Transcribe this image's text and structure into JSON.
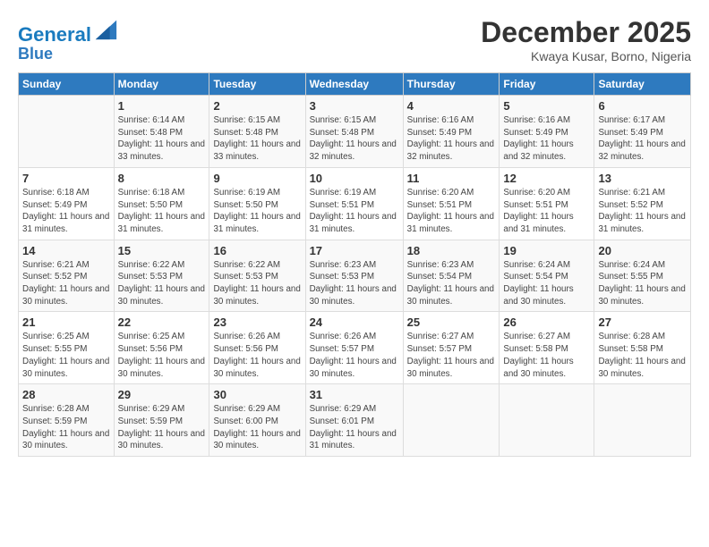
{
  "header": {
    "logo_line1": "General",
    "logo_line2": "Blue",
    "month": "December 2025",
    "location": "Kwaya Kusar, Borno, Nigeria"
  },
  "days_of_week": [
    "Sunday",
    "Monday",
    "Tuesday",
    "Wednesday",
    "Thursday",
    "Friday",
    "Saturday"
  ],
  "weeks": [
    [
      {
        "day": "",
        "info": ""
      },
      {
        "day": "1",
        "info": "Sunrise: 6:14 AM\nSunset: 5:48 PM\nDaylight: 11 hours and 33 minutes."
      },
      {
        "day": "2",
        "info": "Sunrise: 6:15 AM\nSunset: 5:48 PM\nDaylight: 11 hours and 33 minutes."
      },
      {
        "day": "3",
        "info": "Sunrise: 6:15 AM\nSunset: 5:48 PM\nDaylight: 11 hours and 32 minutes."
      },
      {
        "day": "4",
        "info": "Sunrise: 6:16 AM\nSunset: 5:49 PM\nDaylight: 11 hours and 32 minutes."
      },
      {
        "day": "5",
        "info": "Sunrise: 6:16 AM\nSunset: 5:49 PM\nDaylight: 11 hours and 32 minutes."
      },
      {
        "day": "6",
        "info": "Sunrise: 6:17 AM\nSunset: 5:49 PM\nDaylight: 11 hours and 32 minutes."
      }
    ],
    [
      {
        "day": "7",
        "info": "Sunrise: 6:18 AM\nSunset: 5:49 PM\nDaylight: 11 hours and 31 minutes."
      },
      {
        "day": "8",
        "info": "Sunrise: 6:18 AM\nSunset: 5:50 PM\nDaylight: 11 hours and 31 minutes."
      },
      {
        "day": "9",
        "info": "Sunrise: 6:19 AM\nSunset: 5:50 PM\nDaylight: 11 hours and 31 minutes."
      },
      {
        "day": "10",
        "info": "Sunrise: 6:19 AM\nSunset: 5:51 PM\nDaylight: 11 hours and 31 minutes."
      },
      {
        "day": "11",
        "info": "Sunrise: 6:20 AM\nSunset: 5:51 PM\nDaylight: 11 hours and 31 minutes."
      },
      {
        "day": "12",
        "info": "Sunrise: 6:20 AM\nSunset: 5:51 PM\nDaylight: 11 hours and 31 minutes."
      },
      {
        "day": "13",
        "info": "Sunrise: 6:21 AM\nSunset: 5:52 PM\nDaylight: 11 hours and 31 minutes."
      }
    ],
    [
      {
        "day": "14",
        "info": "Sunrise: 6:21 AM\nSunset: 5:52 PM\nDaylight: 11 hours and 30 minutes."
      },
      {
        "day": "15",
        "info": "Sunrise: 6:22 AM\nSunset: 5:53 PM\nDaylight: 11 hours and 30 minutes."
      },
      {
        "day": "16",
        "info": "Sunrise: 6:22 AM\nSunset: 5:53 PM\nDaylight: 11 hours and 30 minutes."
      },
      {
        "day": "17",
        "info": "Sunrise: 6:23 AM\nSunset: 5:53 PM\nDaylight: 11 hours and 30 minutes."
      },
      {
        "day": "18",
        "info": "Sunrise: 6:23 AM\nSunset: 5:54 PM\nDaylight: 11 hours and 30 minutes."
      },
      {
        "day": "19",
        "info": "Sunrise: 6:24 AM\nSunset: 5:54 PM\nDaylight: 11 hours and 30 minutes."
      },
      {
        "day": "20",
        "info": "Sunrise: 6:24 AM\nSunset: 5:55 PM\nDaylight: 11 hours and 30 minutes."
      }
    ],
    [
      {
        "day": "21",
        "info": "Sunrise: 6:25 AM\nSunset: 5:55 PM\nDaylight: 11 hours and 30 minutes."
      },
      {
        "day": "22",
        "info": "Sunrise: 6:25 AM\nSunset: 5:56 PM\nDaylight: 11 hours and 30 minutes."
      },
      {
        "day": "23",
        "info": "Sunrise: 6:26 AM\nSunset: 5:56 PM\nDaylight: 11 hours and 30 minutes."
      },
      {
        "day": "24",
        "info": "Sunrise: 6:26 AM\nSunset: 5:57 PM\nDaylight: 11 hours and 30 minutes."
      },
      {
        "day": "25",
        "info": "Sunrise: 6:27 AM\nSunset: 5:57 PM\nDaylight: 11 hours and 30 minutes."
      },
      {
        "day": "26",
        "info": "Sunrise: 6:27 AM\nSunset: 5:58 PM\nDaylight: 11 hours and 30 minutes."
      },
      {
        "day": "27",
        "info": "Sunrise: 6:28 AM\nSunset: 5:58 PM\nDaylight: 11 hours and 30 minutes."
      }
    ],
    [
      {
        "day": "28",
        "info": "Sunrise: 6:28 AM\nSunset: 5:59 PM\nDaylight: 11 hours and 30 minutes."
      },
      {
        "day": "29",
        "info": "Sunrise: 6:29 AM\nSunset: 5:59 PM\nDaylight: 11 hours and 30 minutes."
      },
      {
        "day": "30",
        "info": "Sunrise: 6:29 AM\nSunset: 6:00 PM\nDaylight: 11 hours and 30 minutes."
      },
      {
        "day": "31",
        "info": "Sunrise: 6:29 AM\nSunset: 6:01 PM\nDaylight: 11 hours and 31 minutes."
      },
      {
        "day": "",
        "info": ""
      },
      {
        "day": "",
        "info": ""
      },
      {
        "day": "",
        "info": ""
      }
    ]
  ]
}
